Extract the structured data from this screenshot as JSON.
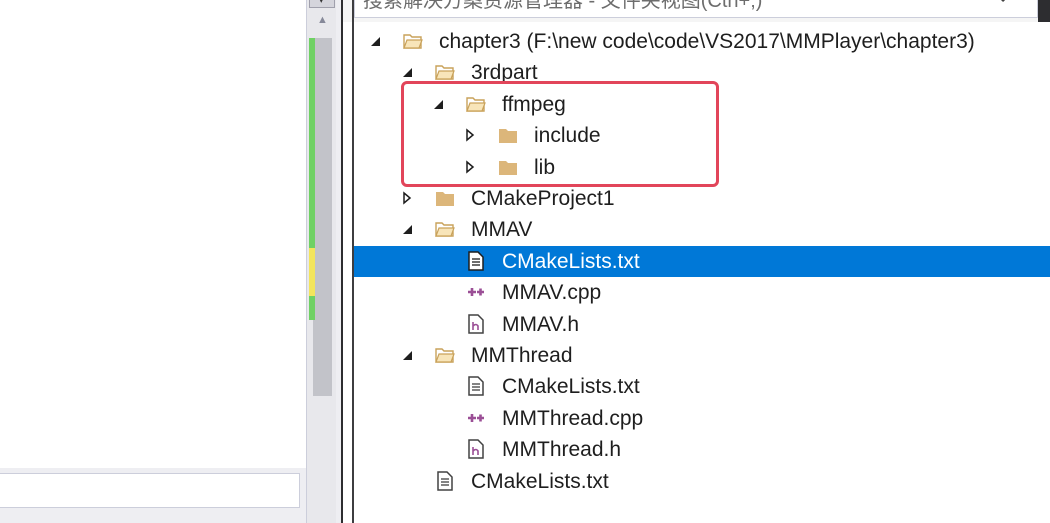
{
  "search": {
    "placeholder": "搜索解决方案资源管理器 - 文件夹视图(Ctrl+;)"
  },
  "tree": [
    {
      "label": "chapter3 (F:\\new code\\code\\VS2017\\MMPlayer\\chapter3)",
      "type": "folder-open",
      "expanded": true,
      "depth": 0
    },
    {
      "label": "3rdpart",
      "type": "folder-open",
      "expanded": true,
      "depth": 1
    },
    {
      "label": "ffmpeg",
      "type": "folder-open",
      "expanded": true,
      "depth": 2
    },
    {
      "label": "include",
      "type": "folder",
      "expanded": false,
      "depth": 3
    },
    {
      "label": "lib",
      "type": "folder",
      "expanded": false,
      "depth": 3
    },
    {
      "label": "CMakeProject1",
      "type": "folder",
      "expanded": false,
      "depth": 1
    },
    {
      "label": "MMAV",
      "type": "folder-open",
      "expanded": true,
      "depth": 1
    },
    {
      "label": "CMakeLists.txt",
      "type": "text-file",
      "depth": 2,
      "selected": true
    },
    {
      "label": "MMAV.cpp",
      "type": "cpp-file",
      "depth": 2
    },
    {
      "label": "MMAV.h",
      "type": "header-file",
      "depth": 2
    },
    {
      "label": "MMThread",
      "type": "folder-open",
      "expanded": true,
      "depth": 1
    },
    {
      "label": "CMakeLists.txt",
      "type": "text-file",
      "depth": 2
    },
    {
      "label": "MMThread.cpp",
      "type": "cpp-file",
      "depth": 2
    },
    {
      "label": "MMThread.h",
      "type": "header-file",
      "depth": 2
    },
    {
      "label": "CMakeLists.txt",
      "type": "text-file",
      "depth": 1
    }
  ],
  "colors": {
    "selection": "#0078d7",
    "highlight_border": "#e2455a",
    "folder": "#dcb67a",
    "cpp": "#9b4f96"
  }
}
